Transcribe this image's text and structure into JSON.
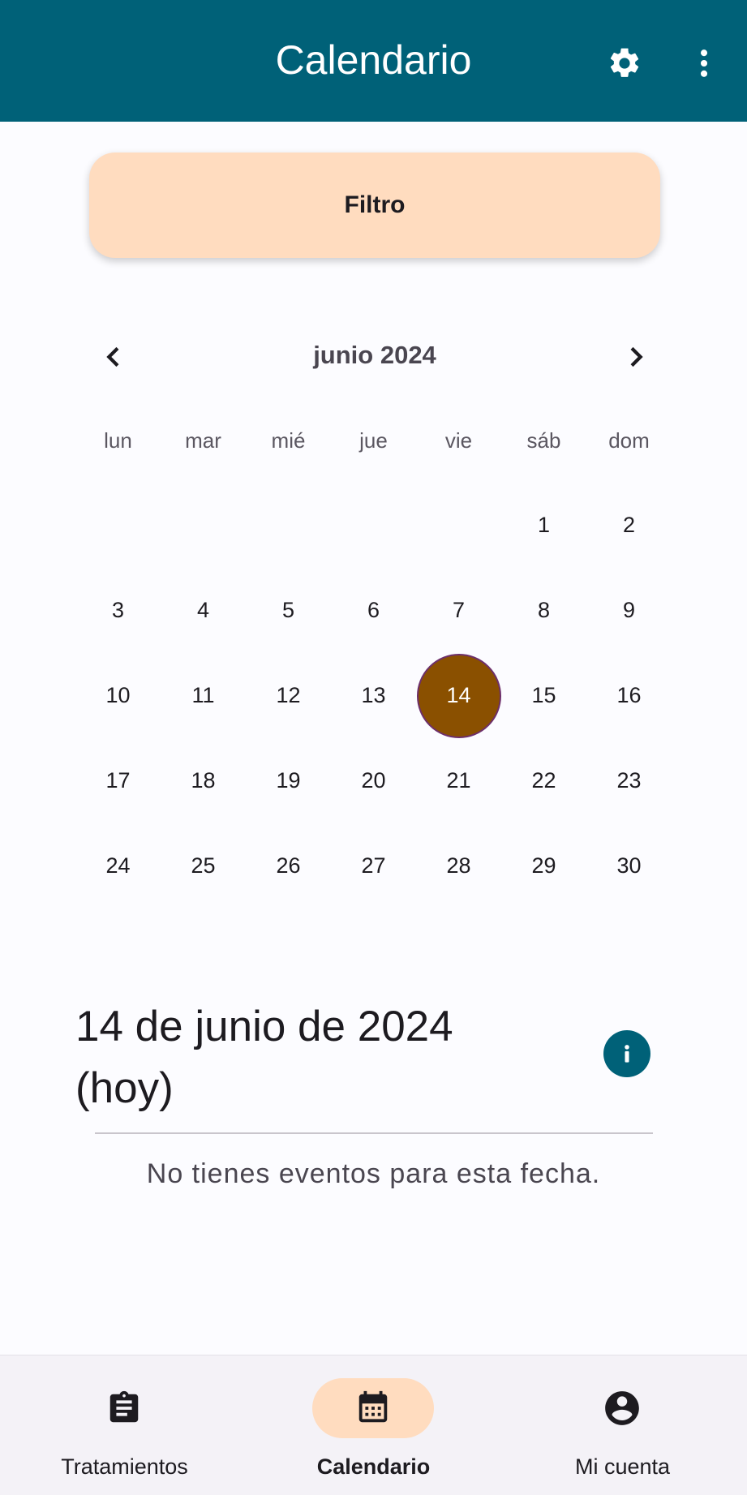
{
  "app_bar": {
    "title": "Calendario",
    "settings_icon": "gear-icon",
    "menu_icon": "more-vert-icon",
    "background": "#006178"
  },
  "filter": {
    "label": "Filtro",
    "background": "#ffdcbf"
  },
  "calendar": {
    "month_label": "junio 2024",
    "weekdays": [
      "lun",
      "mar",
      "mié",
      "jue",
      "vie",
      "sáb",
      "dom"
    ],
    "weeks": [
      [
        "",
        "",
        "",
        "",
        "",
        "1",
        "2"
      ],
      [
        "3",
        "4",
        "5",
        "6",
        "7",
        "8",
        "9"
      ],
      [
        "10",
        "11",
        "12",
        "13",
        "14",
        "15",
        "16"
      ],
      [
        "17",
        "18",
        "19",
        "20",
        "21",
        "22",
        "23"
      ],
      [
        "24",
        "25",
        "26",
        "27",
        "28",
        "29",
        "30"
      ]
    ],
    "selected_day": "14",
    "selected_color": "#8a5000"
  },
  "selected_date": {
    "title": "14 de junio de 2024 (hoy)",
    "empty_message": "No tienes eventos para esta fecha."
  },
  "bottom_nav": {
    "items": [
      {
        "label": "Tratamientos",
        "icon": "clipboard-icon",
        "active": false
      },
      {
        "label": "Calendario",
        "icon": "calendar-icon",
        "active": true
      },
      {
        "label": "Mi cuenta",
        "icon": "account-circle-icon",
        "active": false
      }
    ],
    "active_color": "#ffdcbf"
  }
}
